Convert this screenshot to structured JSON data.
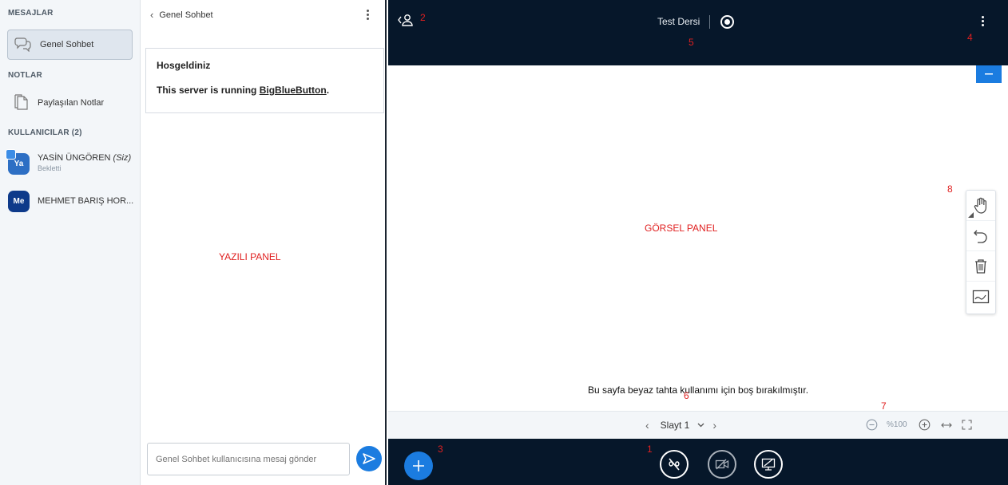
{
  "sidebar": {
    "messages_title": "MESAJLAR",
    "public_chat_label": "Genel Sohbet",
    "notes_title": "NOTLAR",
    "shared_notes_label": "Paylaşılan Notlar",
    "users_title": "KULLANICILAR (2)",
    "users": [
      {
        "initials": "Ya",
        "name": "YASİN ÜNGÖREN",
        "you_tag": "(Siz)",
        "status": "Bekletti",
        "color": "#2d6fc4"
      },
      {
        "initials": "Me",
        "name": "MEHMET BARIŞ HOR...",
        "you_tag": "",
        "status": "",
        "color": "#0e3a8a"
      }
    ]
  },
  "chat": {
    "header": "Genel Sohbet",
    "welcome_title": "Hosgeldiniz",
    "welcome_prefix": "This server is running ",
    "welcome_link": "BigBlueButton",
    "welcome_suffix": ".",
    "panel_label": "YAZILI PANEL",
    "input_placeholder": "Genel Sohbet kullanıcısına mesaj gönder"
  },
  "presentation": {
    "title": "Test Dersi",
    "panel_label": "GÖRSEL PANEL",
    "blank_note": "Bu sayfa beyaz tahta kullanımı için boş bırakılmıştır.",
    "slide_label": "Slayt 1",
    "zoom_value": "%100"
  },
  "annotations": [
    "1",
    "2",
    "3",
    "4",
    "5",
    "6",
    "7",
    "8"
  ],
  "colors": {
    "dark_bar": "#06172a",
    "accent_blue": "#1b7ce0",
    "annotation_red": "#e02020",
    "sidebar_bg": "#f3f6f9"
  },
  "icons": {
    "public_chat": "chat-bubbles-icon",
    "shared_notes": "notes-icon",
    "user_list": "user-list-toggle-icon",
    "more_options": "more-vertical-icon",
    "send": "send-icon",
    "actions": "plus-icon",
    "mute": "microphone-muted-icon",
    "camera": "camera-off-icon",
    "screen_share": "screen-share-icon",
    "hand": "hand-icon",
    "undo": "undo-icon",
    "clear": "trash-icon",
    "multi_user": "whiteboard-icon",
    "zoom_out": "zoom-out-icon",
    "zoom_in": "zoom-in-icon",
    "fit_width": "fit-width-icon",
    "fullscreen": "fullscreen-icon"
  }
}
